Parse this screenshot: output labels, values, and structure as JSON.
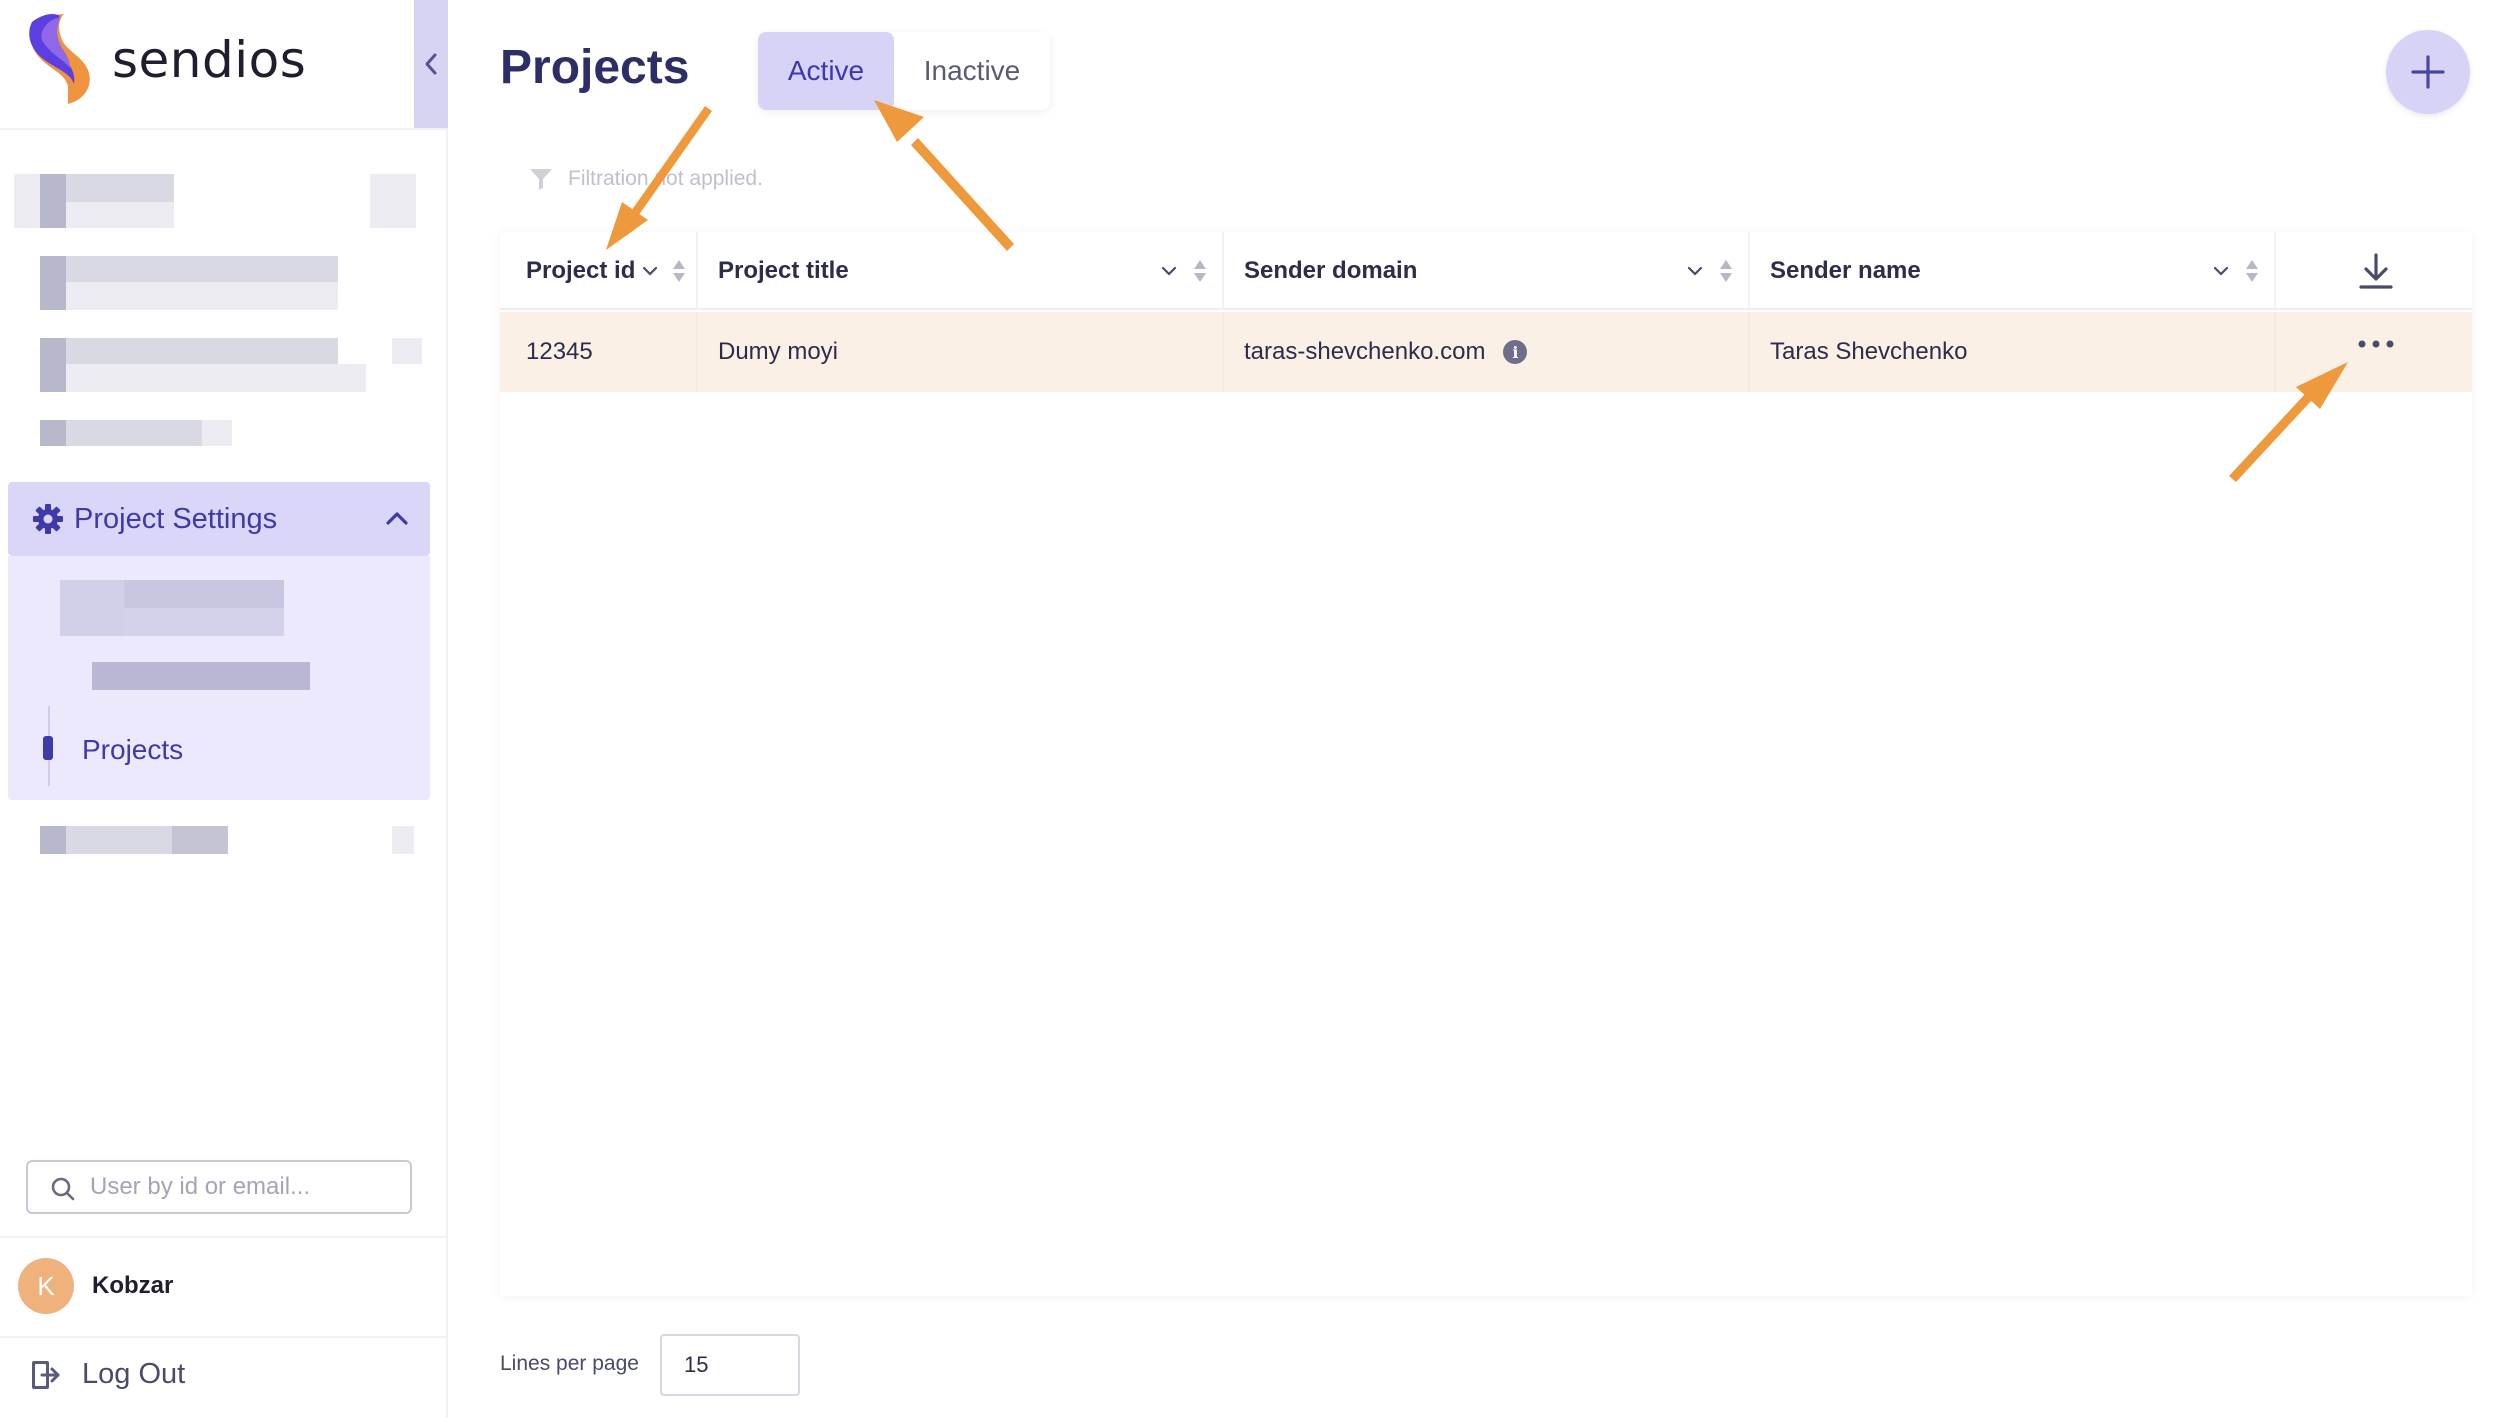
{
  "brand": {
    "name": "sendios"
  },
  "sidebar": {
    "section": {
      "label": "Project Settings",
      "sub_items": [
        {
          "label": "Projects",
          "active": true
        }
      ]
    },
    "search": {
      "placeholder": "User by id or email..."
    },
    "user": {
      "initial": "K",
      "name": "Kobzar"
    },
    "logout_label": "Log Out"
  },
  "main": {
    "title": "Projects",
    "tabs": [
      {
        "label": "Active",
        "selected": true
      },
      {
        "label": "Inactive",
        "selected": false
      }
    ],
    "add_icon": "plus-icon",
    "filter_text": "Filtration not applied.",
    "table": {
      "columns": [
        "Project id",
        "Project title",
        "Sender domain",
        "Sender name"
      ],
      "download_icon": "download-icon",
      "rows": [
        {
          "id": "12345",
          "title": "Dumy moyi",
          "domain": "taras-shevchenko.com",
          "sender_name": "Taras Shevchenko"
        }
      ]
    },
    "pagination": {
      "label": "Lines per page",
      "value": "15"
    }
  },
  "colors": {
    "accent": "#3d37b3",
    "accent_light": "#d6d3f6",
    "row_highlight": "#faf0e6",
    "annotation_arrow": "#ee9a3c"
  }
}
